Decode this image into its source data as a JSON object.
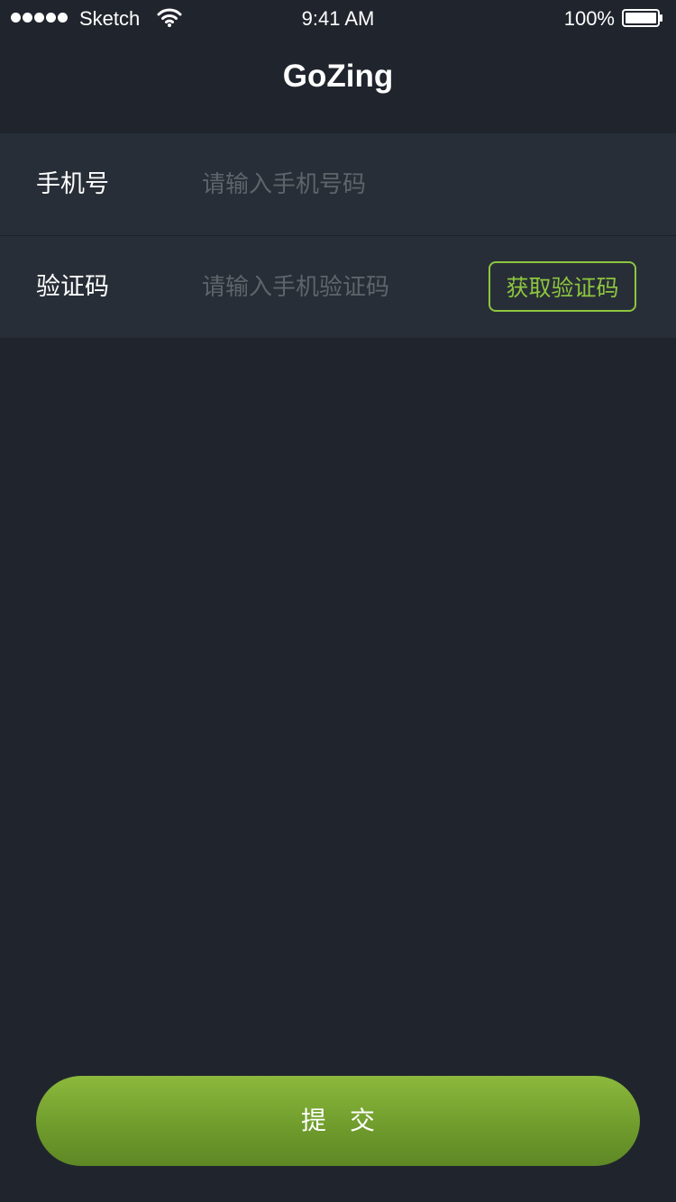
{
  "status_bar": {
    "carrier": "Sketch",
    "time": "9:41 AM",
    "battery": "100%"
  },
  "nav": {
    "title": "GoZing"
  },
  "form": {
    "phone": {
      "label": "手机号",
      "placeholder": "请输入手机号码",
      "value": ""
    },
    "code": {
      "label": "验证码",
      "placeholder": "请输入手机验证码",
      "value": "",
      "get_code_label": "获取验证码"
    }
  },
  "submit_label": "提交",
  "colors": {
    "background": "#20252d",
    "row_background": "#282e37",
    "accent": "#8dc63f",
    "placeholder": "#5f646b"
  },
  "icons": {
    "signal": "signal-dots-icon",
    "wifi": "wifi-icon",
    "battery": "battery-icon"
  }
}
